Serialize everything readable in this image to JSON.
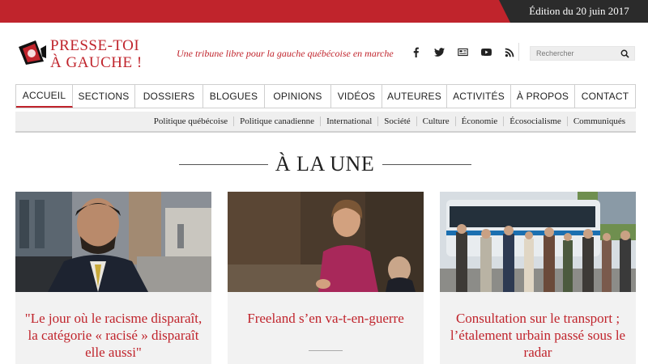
{
  "edition": "Édition du 20 juin 2017",
  "logo": {
    "line1": "PRESSE-TOI",
    "line2": "À GAUCHE !"
  },
  "tagline": "Une tribune libre pour la gauche québécoise en marche",
  "social": [
    "facebook-icon",
    "twitter-icon",
    "newsletter-icon",
    "youtube-icon",
    "rss-icon"
  ],
  "search": {
    "placeholder": "Rechercher"
  },
  "main_nav": [
    "ACCUEIL",
    "SECTIONS",
    "DOSSIERS",
    "BLOGUES",
    "OPINIONS",
    "VIDÉOS",
    "AUTEURES",
    "ACTIVITÉS",
    "À PROPOS",
    "CONTACT"
  ],
  "sub_nav": [
    "Politique québécoise",
    "Politique canadienne",
    "International",
    "Société",
    "Culture",
    "Économie",
    "Écosocialisme",
    "Communiqués"
  ],
  "section_title": "À LA UNE",
  "cards": [
    {
      "headline": "\"Le jour où le racisme disparaît, la catégorie « racisé » disparaît elle aussi\""
    },
    {
      "headline": "Freeland s’en va-t-en-guerre"
    },
    {
      "headline": "Consultation sur le transport ; l’étalement urbain passé sous le radar"
    }
  ],
  "colors": {
    "brand_red": "#c0242c",
    "dark": "#2b2b2b"
  }
}
